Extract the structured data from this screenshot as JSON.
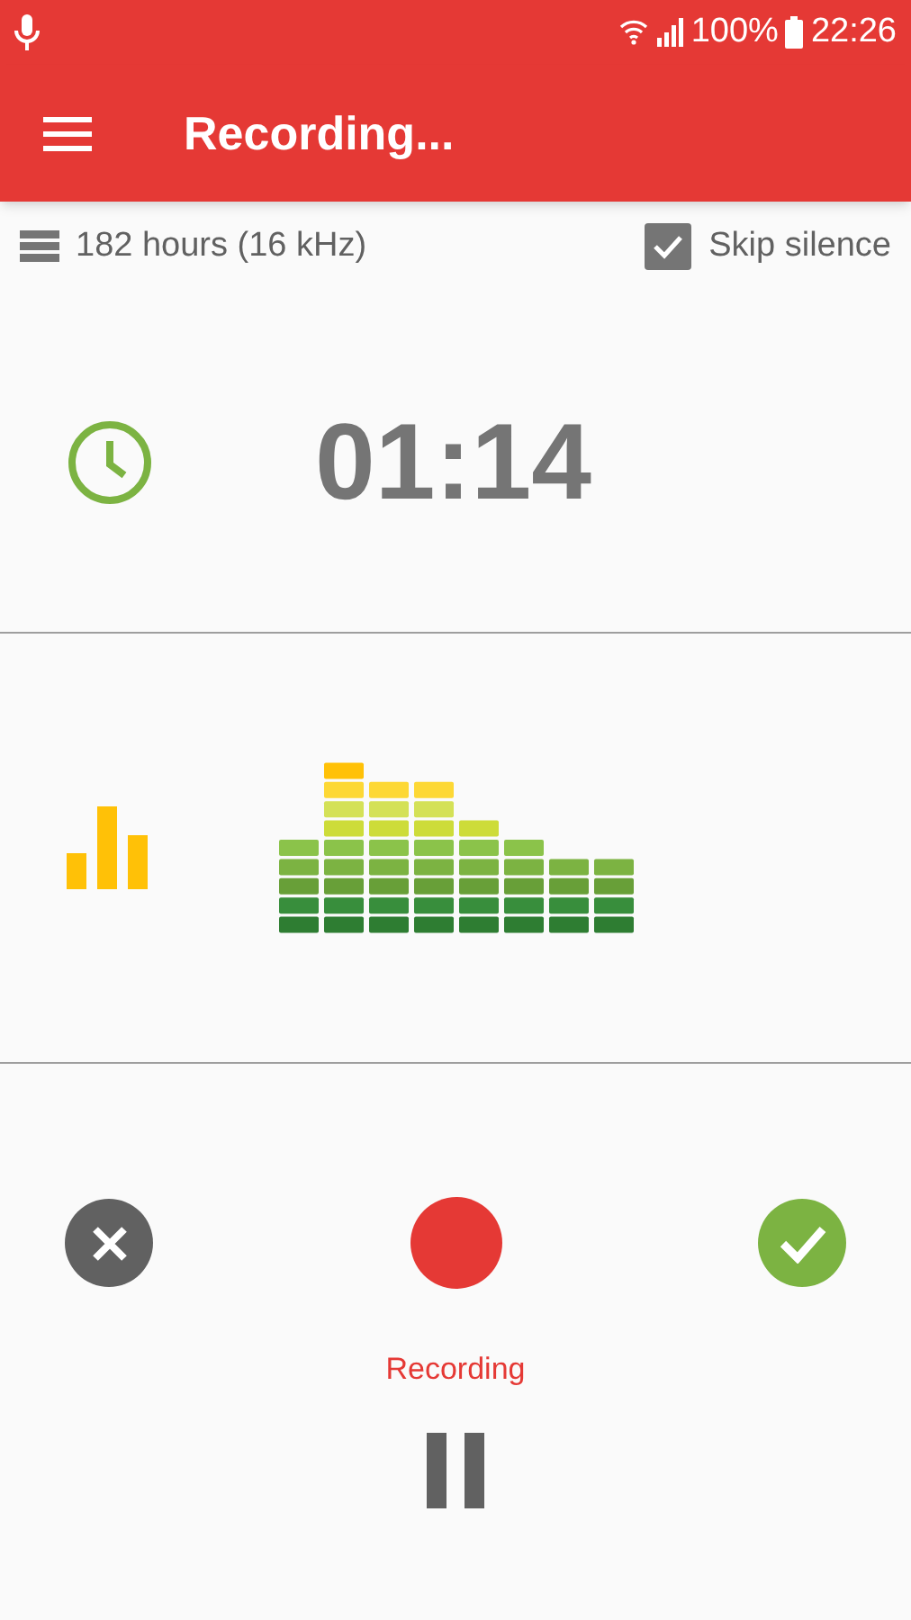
{
  "status_bar": {
    "battery": "100%",
    "time": "22:26"
  },
  "toolbar": {
    "title": "Recording..."
  },
  "info": {
    "storage": "182 hours (16 kHz)",
    "skip_silence": {
      "label": "Skip silence",
      "checked": true
    }
  },
  "timer": {
    "elapsed": "01:14"
  },
  "controls": {
    "status": "Recording"
  }
}
